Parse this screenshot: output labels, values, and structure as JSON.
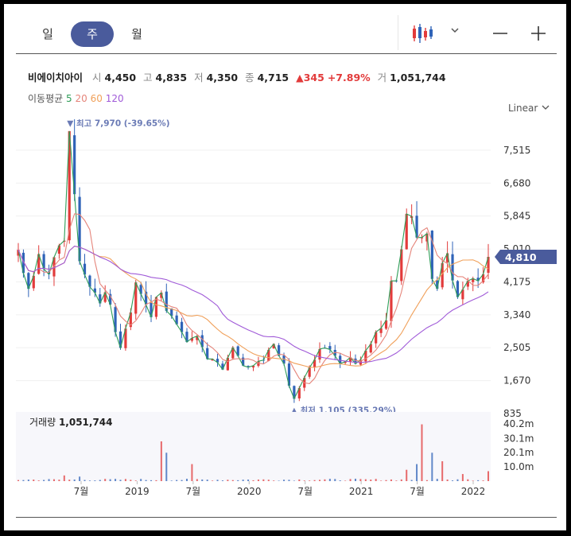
{
  "tabs": {
    "day": "일",
    "week": "주",
    "month": "월"
  },
  "stock": {
    "name": "비에이치아이",
    "open_label": "시",
    "open": "4,450",
    "high_label": "고",
    "high": "4,835",
    "low_label": "저",
    "low": "4,350",
    "close_label": "종",
    "close": "4,715",
    "change": "▲345",
    "change_pct": "+7.89%",
    "volume_label": "거",
    "volume": "1,051,744"
  },
  "ma": {
    "label": "이동평균",
    "periods": [
      "5",
      "20",
      "60",
      "120"
    ],
    "colors": [
      "#2e9d57",
      "#e5847a",
      "#f0a05a",
      "#a05ad8"
    ]
  },
  "scale_label": "Linear",
  "colors": {
    "up": "#e23b3b",
    "down": "#2f63b8",
    "accent": "#4a5b9c",
    "marker": "#6a7ab5"
  },
  "chart_data": {
    "type": "candlestick",
    "y_ticks": [
      "7,515",
      "6,680",
      "5,845",
      "5,010",
      "4,175",
      "3,340",
      "2,505",
      "1,670",
      "835"
    ],
    "ylim": [
      835,
      8300
    ],
    "x_tick_labels": [
      "7월",
      "2019",
      "7월",
      "2020",
      "7월",
      "2021",
      "7월",
      "2022"
    ],
    "current_price": "4,810",
    "high_marker": "▼ 최고 7,970 (-39.65%)",
    "low_marker": "▲ 최저 1,105 (335.29%)",
    "high_value": 7970,
    "low_value": 1105,
    "close_series": [
      4990,
      4400,
      4000,
      4330,
      4880,
      4500,
      4370,
      4800,
      5100,
      5220,
      8000,
      6400,
      4700,
      4360,
      4050,
      3900,
      3630,
      3910,
      3600,
      2900,
      2500,
      2990,
      3400,
      4160,
      3870,
      3600,
      3280,
      3790,
      3900,
      3440,
      3310,
      3100,
      2900,
      2650,
      2750,
      2800,
      2520,
      2220,
      2220,
      2130,
      1950,
      2250,
      2510,
      2300,
      2050,
      2010,
      2050,
      2160,
      2190,
      2450,
      2600,
      2300,
      2100,
      1540,
      1210,
      1480,
      1740,
      2000,
      2200,
      2470,
      2500,
      2460,
      2300,
      2100,
      2150,
      2260,
      2100,
      2200,
      2430,
      2600,
      2900,
      3000,
      3200,
      4200,
      4200,
      5000,
      5900,
      5840,
      5300,
      5300,
      5400,
      4250,
      4000,
      4650,
      4900,
      4210,
      3790,
      3980,
      4200,
      4260,
      4200,
      4370,
      4810
    ],
    "ma_periods": [
      5,
      20,
      60,
      120
    ],
    "volume": {
      "label": "거래량",
      "value": "1,051,744",
      "ticks": [
        "40.2m",
        "30.1m",
        "20.1m",
        "10.0m"
      ],
      "max": 42,
      "spikes": [
        [
          9,
          4.0
        ],
        [
          12,
          3.2
        ],
        [
          28,
          28.0
        ],
        [
          29,
          20.0
        ],
        [
          34,
          12.0
        ],
        [
          76,
          8.0
        ],
        [
          78,
          12.0
        ],
        [
          79,
          40.0
        ],
        [
          81,
          20.0
        ],
        [
          83,
          14.0
        ],
        [
          87,
          5.0
        ],
        [
          92,
          7.0
        ]
      ]
    }
  }
}
